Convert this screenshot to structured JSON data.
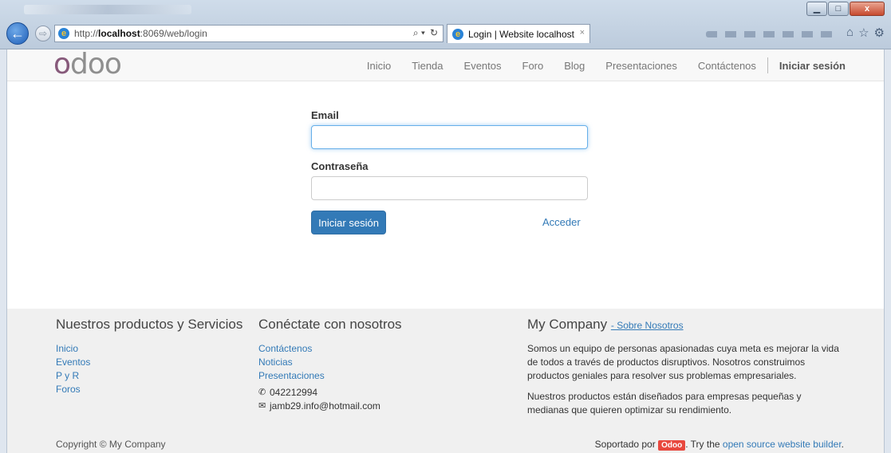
{
  "browser": {
    "url_prefix": "http://",
    "url_host": "localhost",
    "url_rest": ":8069/web/login",
    "tab_title": "Login | Website localhost",
    "tab_close": "×",
    "back_glyph": "←",
    "forward_glyph": "⇨",
    "search_glyph": "⌕ ▾",
    "refresh_glyph": "↻",
    "home_glyph": "⌂",
    "favorites_glyph": "☆",
    "settings_glyph": "⚙",
    "minimize_glyph": "▁",
    "maximize_glyph": "□",
    "close_glyph": "x"
  },
  "site": {
    "logo_part1": "o",
    "logo_part2": "doo",
    "menu": [
      "Inicio",
      "Tienda",
      "Eventos",
      "Foro",
      "Blog",
      "Presentaciones",
      "Contáctenos"
    ],
    "login_label": "Iniciar sesión"
  },
  "form": {
    "email_label": "Email",
    "email_value": "",
    "password_label": "Contraseña",
    "password_value": "",
    "submit_label": "Iniciar sesión",
    "acceder_label": "Acceder"
  },
  "footer": {
    "col1_title": "Nuestros productos y Servicios",
    "col1_links": [
      "Inicio",
      "Eventos",
      "P y R",
      "Foros"
    ],
    "col2_title": "Conéctate con nosotros",
    "col2_links": [
      "Contáctenos",
      "Noticias",
      "Presentaciones"
    ],
    "phone": "042212994",
    "email": "jamb29.info@hotmail.com",
    "col3_title": "My Company",
    "col3_subtitle": "- Sobre Nosotros",
    "about_p1": "Somos un equipo de personas apasionadas cuya meta es mejorar la vida de todos a través de productos disruptivos. Nosotros construimos productos geniales para resolver sus problemas empresariales.",
    "about_p2": "Nuestros productos están diseñados para empresas pequeñas y medianas que quieren optimizar su rendimiento.",
    "copyright": "Copyright © My Company",
    "powered_prefix": "Soportado por",
    "powered_badge": "Odoo",
    "powered_mid": ". Try the",
    "powered_link": "open source website builder",
    "powered_end": "."
  },
  "colors": {
    "brand_purple": "#875a7b",
    "link_blue": "#337ab7",
    "primary_button": "#337ab7",
    "odoo_badge": "#e8483e"
  }
}
